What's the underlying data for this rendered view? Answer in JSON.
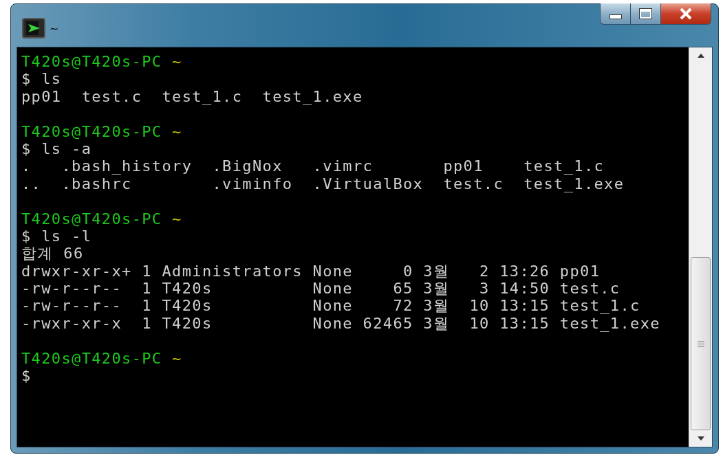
{
  "window": {
    "title": "~"
  },
  "lines": [
    {
      "kind": "prompt",
      "user_host": "T420s@T420s-PC",
      "path": "~"
    },
    {
      "kind": "output",
      "text": "$ ls"
    },
    {
      "kind": "output",
      "text": "pp01  test.c  test_1.c  test_1.exe"
    },
    {
      "kind": "blank"
    },
    {
      "kind": "prompt",
      "user_host": "T420s@T420s-PC",
      "path": "~"
    },
    {
      "kind": "output",
      "text": "$ ls -a"
    },
    {
      "kind": "output",
      "text": ".   .bash_history  .BigNox   .vimrc       pp01    test_1.c"
    },
    {
      "kind": "output",
      "text": "..  .bashrc        .viminfo  .VirtualBox  test.c  test_1.exe"
    },
    {
      "kind": "blank"
    },
    {
      "kind": "prompt",
      "user_host": "T420s@T420s-PC",
      "path": "~"
    },
    {
      "kind": "output",
      "text": "$ ls -l"
    },
    {
      "kind": "output",
      "text": "합계 66"
    },
    {
      "kind": "output",
      "text": "drwxr-xr-x+ 1 Administrators None     0 3월   2 13:26 pp01"
    },
    {
      "kind": "output",
      "text": "-rw-r--r--  1 T420s          None    65 3월   3 14:50 test.c"
    },
    {
      "kind": "output",
      "text": "-rw-r--r--  1 T420s          None    72 3월  10 13:15 test_1.c"
    },
    {
      "kind": "output",
      "text": "-rwxr-xr-x  1 T420s          None 62465 3월  10 13:15 test_1.exe"
    },
    {
      "kind": "blank"
    },
    {
      "kind": "prompt",
      "user_host": "T420s@T420s-PC",
      "path": "~"
    },
    {
      "kind": "output",
      "text": "$"
    }
  ]
}
